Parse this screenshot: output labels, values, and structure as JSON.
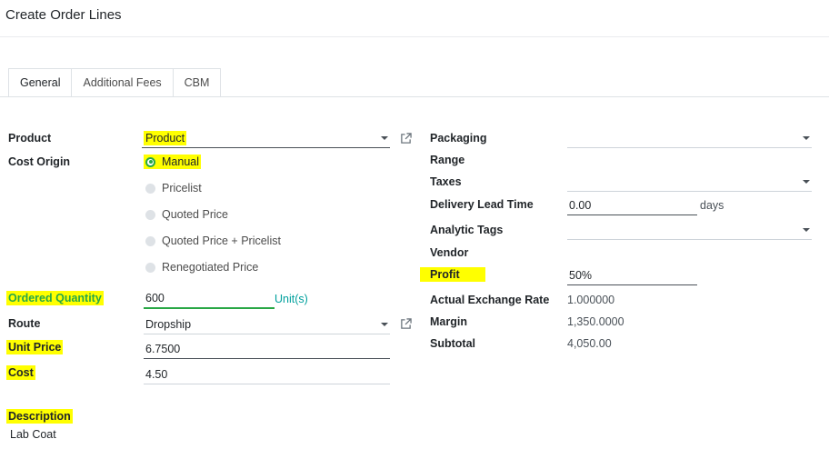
{
  "dialog": {
    "title": "Create Order Lines"
  },
  "tabs": [
    {
      "label": "General"
    },
    {
      "label": "Additional Fees"
    },
    {
      "label": "CBM"
    }
  ],
  "left": {
    "product": {
      "label": "Product",
      "value": "Product"
    },
    "cost_origin": {
      "label": "Cost Origin",
      "options": [
        "Manual",
        "Pricelist",
        "Quoted Price",
        "Quoted Price + Pricelist",
        "Renegotiated Price"
      ],
      "selected": "Manual"
    },
    "ordered_quantity": {
      "label": "Ordered Quantity",
      "value": "600",
      "unit": "Unit(s)"
    },
    "route": {
      "label": "Route",
      "value": "Dropship"
    },
    "unit_price": {
      "label": "Unit Price",
      "value": "6.7500"
    },
    "cost": {
      "label": "Cost",
      "value": "4.50"
    },
    "description": {
      "label": "Description",
      "value": "Lab Coat"
    }
  },
  "right": {
    "packaging": {
      "label": "Packaging",
      "value": ""
    },
    "range": {
      "label": "Range"
    },
    "taxes": {
      "label": "Taxes",
      "value": ""
    },
    "delivery_lead_time": {
      "label": "Delivery Lead Time",
      "value": "0.00",
      "unit": "days"
    },
    "analytic_tags": {
      "label": "Analytic Tags",
      "value": ""
    },
    "vendor": {
      "label": "Vendor"
    },
    "profit": {
      "label": "Profit",
      "value": "50%"
    },
    "actual_exchange_rate": {
      "label": "Actual Exchange Rate",
      "value": "1.000000"
    },
    "margin": {
      "label": "Margin",
      "value": "1,350.0000"
    },
    "subtotal": {
      "label": "Subtotal",
      "value": "4,050.00"
    }
  },
  "colors": {
    "accent": "#28a745",
    "highlight": "#ffff00",
    "unit": "#00a09d"
  },
  "icons": {
    "external_link": "external-link-icon",
    "dropdown": "chevron-down-icon"
  }
}
